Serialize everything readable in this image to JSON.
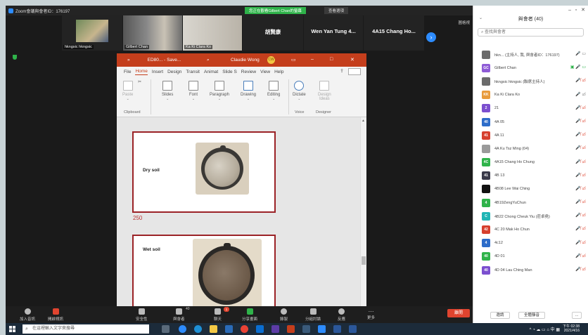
{
  "zoom": {
    "title": "Zoom會議與會者ID：176197",
    "viewing_banner": "您正在觀看Gilbert Chan的螢幕",
    "view_options": "查看選項",
    "gallery_label": "圖格視",
    "tiles": [
      {
        "name": "hkngsic hkngsic"
      },
      {
        "name": "Gilbert Chan"
      },
      {
        "name": "Ka Ki Clara Ko"
      },
      {
        "name": "胡賢康"
      },
      {
        "name": "Wen Yan Tung 4..."
      },
      {
        "name": "4A15 Chang Ho..."
      }
    ],
    "toolbar": {
      "audio": "加入音訊",
      "video": "開啟視訊",
      "security": "安全性",
      "participants": "與會者",
      "participants_count": "40",
      "chat": "聊天",
      "chat_badge": "1",
      "share": "分享畫面",
      "record": "錄製",
      "breakout": "分組討論",
      "reactions": "反應",
      "more": "更多",
      "leave": "離開"
    }
  },
  "ppt": {
    "quick_access": "»",
    "filename": "ED80... - Save...",
    "user": "Claudie Wong",
    "user_initials": "CW",
    "tabs": [
      "File",
      "Home",
      "Insert",
      "Design",
      "Transit",
      "Animat",
      "Slide S",
      "Review",
      "View",
      "Help"
    ],
    "active_tab": "Home",
    "ribbon": {
      "paste": "Paste",
      "slides": "Slides",
      "font": "Font",
      "paragraph": "Paragraph",
      "drawing": "Drawing",
      "editing": "Editing",
      "dictate": "Dictate",
      "design_ideas_1": "Design",
      "design_ideas_2": "Ideas",
      "clipboard": "Clipboard",
      "voice": "Voice",
      "designer": "Designer"
    },
    "slides": [
      {
        "label": "Dry soil",
        "number": "250"
      },
      {
        "label": "Wet soil"
      }
    ]
  },
  "participants_panel": {
    "title": "與會者 (40)",
    "search_placeholder": "查找與會者",
    "invite": "邀請",
    "mute_all": "全體靜音",
    "more": "...",
    "colors": {
      "red": "#e0442f",
      "green": "#2fb34a",
      "purple": "#7b4fcf",
      "blue": "#2d8cff"
    },
    "people": [
      {
        "initials": "",
        "name": "hkn... (主持人, 我, 與會者ID：176197)",
        "color": "#6b6b6b",
        "status": "cam"
      },
      {
        "initials": "GC",
        "name": "Gilbert Chan",
        "color": "#8e5bd6",
        "status": "sharing"
      },
      {
        "initials": "",
        "name": "hkngsic hkngsic (聯席主持人)",
        "color": "#6b6b6b",
        "status": "muted"
      },
      {
        "initials": "KK",
        "name": "Ka Ki Clara Ko",
        "color": "#e89b3c",
        "status": "mic"
      },
      {
        "initials": "2",
        "name": "21",
        "color": "#7b4fcf",
        "status": "muted"
      },
      {
        "initials": "40",
        "name": "4A 05",
        "color": "#2d6cc9",
        "status": "muted"
      },
      {
        "initials": "41",
        "name": "4A 11",
        "color": "#d6402e",
        "status": "muted"
      },
      {
        "initials": "",
        "name": "4A Ku Tsz Ming (04)",
        "color": "#9a9a9a",
        "status": "muted"
      },
      {
        "initials": "4C",
        "name": "4A15 Chang Ho Chung",
        "color": "#2fb34a",
        "status": "muted"
      },
      {
        "initials": "41",
        "name": "4B 13",
        "color": "#3a3a4a",
        "status": "muted"
      },
      {
        "initials": "",
        "name": "4B08 Lee Wai Ching",
        "color": "#111111",
        "status": "muted"
      },
      {
        "initials": "4",
        "name": "4B19ZengYuChun",
        "color": "#2fb34a",
        "status": "muted"
      },
      {
        "initials": "C",
        "name": "4B22 Chong Cheuk Yiu (莊卓堯)",
        "color": "#1fb5b5",
        "status": "muted"
      },
      {
        "initials": "42",
        "name": "4C 20 Mak Ho Chun",
        "color": "#d6402e",
        "status": "muted"
      },
      {
        "initials": "4",
        "name": "4c12",
        "color": "#2d6cc9",
        "status": "muted"
      },
      {
        "initials": "40",
        "name": "4D 01",
        "color": "#2fb34a",
        "status": "muted"
      },
      {
        "initials": "40",
        "name": "4D 04 Lau Ching Man",
        "color": "#7b4fcf",
        "status": "muted"
      }
    ]
  },
  "taskbar": {
    "search_placeholder": "在這裡輸入文字來搜尋",
    "time": "下午 02:38",
    "date": "2021/4/16"
  }
}
